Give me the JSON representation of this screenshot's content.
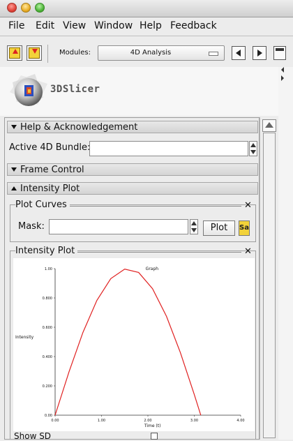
{
  "menu": [
    "File",
    "Edit",
    "View",
    "Window",
    "Help",
    "Feedback"
  ],
  "toolbar": {
    "modules_label": "Modules:",
    "modules_value": "4D Analysis"
  },
  "logo_text": "3DSlicer",
  "sections": {
    "help": "Help & Acknowledgement",
    "active_bundle_label": "Active 4D Bundle:",
    "frame_control": "Frame Control",
    "intensity_plot": "Intensity Plot"
  },
  "plot_curves": {
    "title": "Plot Curves",
    "mask_label": "Mask:",
    "plot_button": "Plot",
    "save_button": "Sa"
  },
  "intensity_plot_box": {
    "title": "Intensity Plot"
  },
  "bottom_text": "Show SD",
  "colors": {
    "curve": "#e02020",
    "accent": "#f2d23a"
  },
  "chart_data": {
    "type": "line",
    "legend": "Graph",
    "xlabel": "Time (t)",
    "ylabel": "Intensity",
    "xlim": [
      0,
      4
    ],
    "ylim": [
      0,
      1
    ],
    "xticks": [
      "0.00",
      "1.00",
      "2.00",
      "3.00",
      "4.00"
    ],
    "yticks": [
      "0.00",
      "0.200",
      "0.400",
      "0.600",
      "0.800",
      "1.00"
    ],
    "series": [
      {
        "x": [
          0,
          0.3,
          0.6,
          0.9,
          1.2,
          1.5,
          1.8,
          2.1,
          2.4,
          2.7,
          3.0,
          3.14
        ],
        "y": [
          0,
          0.296,
          0.565,
          0.783,
          0.932,
          0.997,
          0.974,
          0.863,
          0.675,
          0.427,
          0.141,
          0.0
        ]
      }
    ]
  }
}
